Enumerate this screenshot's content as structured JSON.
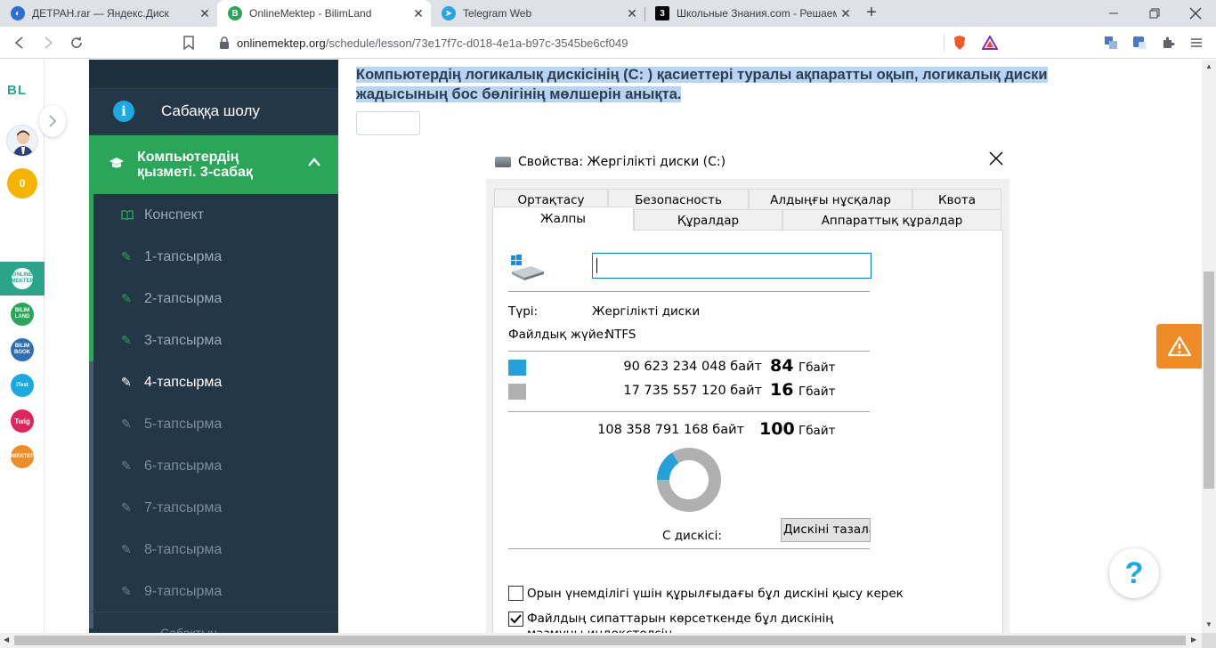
{
  "browser": {
    "tabs": [
      {
        "title": "ДЕТРАН.rar — Яндекс.Диск",
        "close": "✕"
      },
      {
        "title": "OnlineMektep - BilimLand",
        "close": "✕"
      },
      {
        "title": "Telegram Web",
        "close": "✕"
      },
      {
        "title": "Школьные Знания.com - Решаем",
        "close": "✕"
      }
    ],
    "new_tab": "+",
    "url_host": "onlinemektep.org",
    "url_path": "/schedule/lesson/73e17f7c-d018-4e1a-b97c-3545be6cf049"
  },
  "rail": {
    "logo": "BL",
    "coins": "0",
    "apps": [
      "ONLINE MEKTEP",
      "BILIM LAND",
      "BILIM BOOK",
      "iTest",
      "Twig",
      "IMEKTEP"
    ]
  },
  "sidebar": {
    "overview": "Сабаққа шолу",
    "lesson": "Компьютердің қызметі. 3-сабақ",
    "items": [
      {
        "label": "Конспект"
      },
      {
        "label": "1-тапсырма"
      },
      {
        "label": "2-тапсырма"
      },
      {
        "label": "3-тапсырма"
      },
      {
        "label": "4-тапсырма"
      },
      {
        "label": "5-тапсырма"
      },
      {
        "label": "6-тапсырма"
      },
      {
        "label": "7-тапсырма"
      },
      {
        "label": "8-тапсырма"
      },
      {
        "label": "9-тапсырма"
      }
    ],
    "bottom": "Сабақтың"
  },
  "task": {
    "title": "Компьютердің логикалық дискісінің (C: ) қасиеттері туралы ақпаратты оқып, логикалық диски жадысының бос бөлігінің мөлшерін анықта.",
    "answer": ""
  },
  "dialog": {
    "title": "Свойства: Жергілікті диски (C:)",
    "tabs_row1": [
      "Ортақтасу",
      "Безопасность",
      "Алдыңғы нұсқалар",
      "Квота"
    ],
    "tabs_row2": [
      "Жалпы",
      "Құралдар",
      "Аппараттық құралдар"
    ],
    "type_label": "Түрі:",
    "type_value": "Жергілікті диски",
    "fs_label": "Файлдық жүйе:",
    "fs_value": "NTFS",
    "used_bytes": "90 623 234 048 байт",
    "used_gb": "84",
    "free_bytes": "17 735 557 120 байт",
    "free_gb": "16",
    "total_bytes": "108 358 791 168 байт",
    "total_gb": "100",
    "unit": "Гбайт",
    "drive_label": "C дискісі:",
    "clean_button": "Дискіні тазалау",
    "compress_label": "Орын үнемділігі үшін құрылғыдағы бұл дискіні қысу керек",
    "index_label": "Файлдың сипаттарын көрсеткенде бұл дискінің мазмұны индекстелсін",
    "used_fraction": 0.84,
    "colors": {
      "used": "#26a0da",
      "free": "#b0b0b0"
    }
  },
  "floating": {
    "help": "?"
  }
}
